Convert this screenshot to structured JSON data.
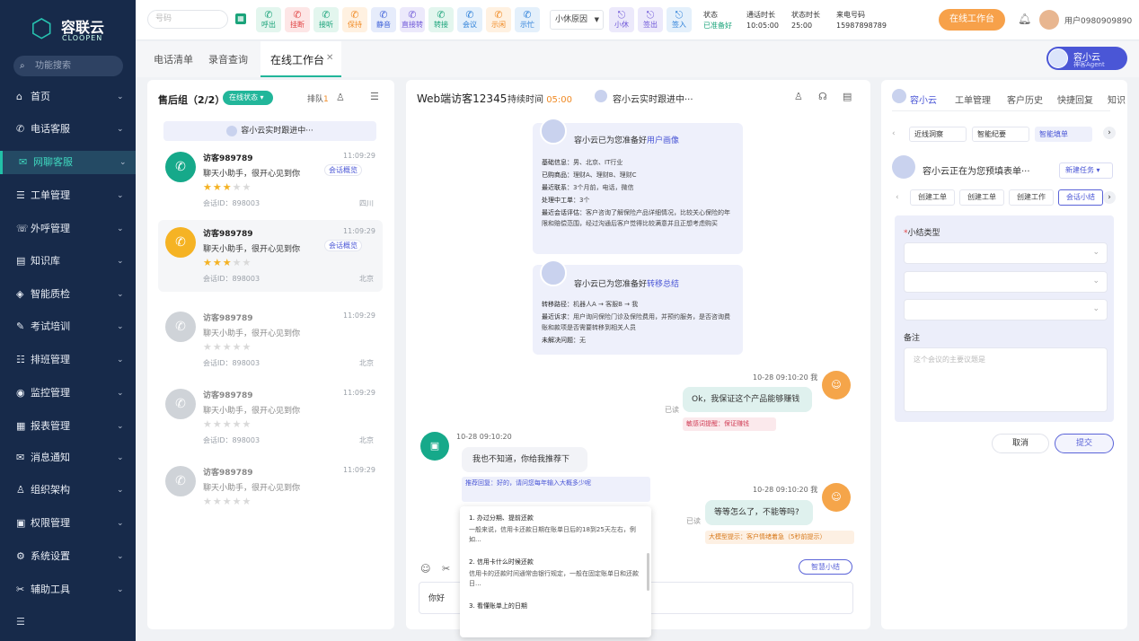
{
  "brand": {
    "title": "容联云",
    "subtitle": "CLOOPEN"
  },
  "sidebar": {
    "search_placeholder": "功能搜索",
    "items": [
      {
        "icon": "home-icon",
        "glyph": "⌂",
        "label": "首页"
      },
      {
        "icon": "phone-icon",
        "glyph": "✆",
        "label": "电话客服"
      },
      {
        "icon": "chat-icon",
        "glyph": "✉",
        "label": "网聊客服"
      },
      {
        "icon": "ticket-icon",
        "glyph": "☰",
        "label": "工单管理"
      },
      {
        "icon": "outbound-icon",
        "glyph": "☏",
        "label": "外呼管理"
      },
      {
        "icon": "book-icon",
        "glyph": "▤",
        "label": "知识库"
      },
      {
        "icon": "shield-icon",
        "glyph": "◈",
        "label": "智能质检"
      },
      {
        "icon": "exam-icon",
        "glyph": "✎",
        "label": "考试培训"
      },
      {
        "icon": "schedule-icon",
        "glyph": "☷",
        "label": "排班管理"
      },
      {
        "icon": "monitor-icon",
        "glyph": "◉",
        "label": "监控管理"
      },
      {
        "icon": "report-icon",
        "glyph": "▦",
        "label": "报表管理"
      },
      {
        "icon": "bell-icon",
        "glyph": "✉",
        "label": "消息通知"
      },
      {
        "icon": "org-icon",
        "glyph": "♙",
        "label": "组织架构"
      },
      {
        "icon": "permission-icon",
        "glyph": "▣",
        "label": "权限管理"
      },
      {
        "icon": "settings-icon",
        "glyph": "⚙",
        "label": "系统设置"
      },
      {
        "icon": "tool-icon",
        "glyph": "✂",
        "label": "辅助工具"
      }
    ]
  },
  "topbar": {
    "search_placeholder": "号码",
    "tools": [
      {
        "label": "呼出",
        "bg": "#e3f6ee",
        "fg": "#1aa37a"
      },
      {
        "label": "挂断",
        "bg": "#fde6e6",
        "fg": "#e04545"
      },
      {
        "label": "接听",
        "bg": "#e3f6ee",
        "fg": "#1aa37a"
      },
      {
        "label": "保持",
        "bg": "#fff1e1",
        "fg": "#f08a24"
      },
      {
        "label": "静音",
        "bg": "#e6ecfb",
        "fg": "#4062d8"
      },
      {
        "label": "直接转",
        "bg": "#ece9fb",
        "fg": "#6f58d8"
      },
      {
        "label": "转接",
        "bg": "#e3f6ee",
        "fg": "#1aa37a"
      },
      {
        "label": "会议",
        "bg": "#e4f0fb",
        "fg": "#2a7ed8"
      },
      {
        "label": "示闲",
        "bg": "#fff1e1",
        "fg": "#f08a24"
      },
      {
        "label": "示忙",
        "bg": "#e4f0fb",
        "fg": "#2a7ed8"
      }
    ],
    "state_select": "小休原因",
    "tools2": [
      {
        "label": "小休",
        "bg": "#ece9fb",
        "fg": "#6f58d8"
      },
      {
        "label": "签出",
        "bg": "#ece9fb",
        "fg": "#6f58d8"
      },
      {
        "label": "签入",
        "bg": "#e4f0fb",
        "fg": "#2a7ed8"
      }
    ],
    "status_label": "状态",
    "status_value": "已准备好",
    "talk_label": "通话时长",
    "talk_value": "10:05:00",
    "state_time_label": "状态时长",
    "state_time_value": "25:00",
    "caller_label": "来电号码",
    "caller_value": "15987898789",
    "workbench_btn": "在线工作台",
    "user": "用户0980909890"
  },
  "page_tabs": [
    "电话清单",
    "录音查询",
    "在线工作台"
  ],
  "agent_badge": {
    "name": "容小云",
    "role": "神客Agent"
  },
  "queue": {
    "title": "售后组（2/2）",
    "status": "在线状态",
    "queue_label": "排队",
    "queue_count": "1",
    "banner": "容小云实时跟进中···",
    "items": [
      {
        "name": "访客989789",
        "msg": "聊天小助手，很开心见到你",
        "time": "11:09:29",
        "stars": 3,
        "id": "会话ID：898003",
        "loc": "四川",
        "tag": "会话概览",
        "color": "#16a98a",
        "active": true
      },
      {
        "name": "访客989789",
        "msg": "聊天小助手，很开心见到你",
        "time": "11:09:29",
        "stars": 3,
        "id": "会话ID：898003",
        "loc": "北京",
        "tag": "会话概览",
        "color": "#f5b324",
        "active": true
      },
      {
        "name": "访客989789",
        "msg": "聊天小助手，很开心见到你",
        "time": "11:09:29",
        "stars": 0,
        "id": "会话ID：898003",
        "loc": "北京",
        "tag": "",
        "color": "#cfd3d8",
        "active": false
      },
      {
        "name": "访客989789",
        "msg": "聊天小助手，很开心见到你",
        "time": "11:09:29",
        "stars": 0,
        "id": "会话ID：898003",
        "loc": "北京",
        "tag": "",
        "color": "#cfd3d8",
        "active": false
      },
      {
        "name": "访客989789",
        "msg": "聊天小助手，很开心见到你",
        "time": "11:09:29",
        "stars": 0,
        "id": "",
        "loc": "",
        "tag": "",
        "color": "#cfd3d8",
        "active": false
      }
    ]
  },
  "chat": {
    "title": "Web端访客12345",
    "duration_label": "持续时间",
    "duration": "05:00",
    "following": "容小云实时跟进中···",
    "portrait_card": {
      "heading_a": "容小云已为您准备好",
      "heading_b": "用户画像",
      "rows": [
        {
          "k": "基础信息：",
          "v": "男、北京、IT行业"
        },
        {
          "k": "已购商品：",
          "v": "理财A、理财B、理财C"
        },
        {
          "k": "最近联系：",
          "v": "3个月前，电话，微信"
        },
        {
          "k": "处理中工单：",
          "v": "3个"
        },
        {
          "k": "最近会话评估：",
          "v": "客户咨询了解保险产品详细情况，比较关心保险的年限和赔偿范围，经过沟通后客户觉得比较满意并且正想考虑购买"
        }
      ]
    },
    "transfer_card": {
      "heading_a": "容小云已为您准备好",
      "heading_b": "转移总结",
      "rows": [
        {
          "k": "转移路径：",
          "v": "机器人A → 客服B → 我"
        },
        {
          "k": "最近诉求：",
          "v": "用户询问保险门诊及保险费用，并预约服务，是否咨询费账和款项是否需要转移到相关人员"
        },
        {
          "k": "未解决问题：",
          "v": "无"
        }
      ]
    },
    "msg_out1": {
      "time": "10-28 09:10:20",
      "who": "我",
      "text": "Ok，我保证这个产品能够赚钱",
      "read": "已读",
      "hint_label": "敏感词提醒：",
      "hint_value": "保证赚钱"
    },
    "msg_in": {
      "time": "10-28 09:10:20",
      "text": "我也不知道，你给我推荐下",
      "rec_label": "推荐回复：",
      "rec_text": "好的，请问您每年输入大概多少呢"
    },
    "msg_out2": {
      "time": "10-28 09:10:20",
      "who": "我",
      "text": "等等怎么了，不能等吗?",
      "read": "已读",
      "hint_label": "大模型提示：",
      "hint_value": "客户情绪着急（5秒前提示）"
    },
    "suggestions": [
      {
        "title": "1. 办过分期、提前还款",
        "body": "一般来说，信用卡还款日期在账单日后的18到25天左右，例如..."
      },
      {
        "title": "2. 信用卡什么时候还款",
        "body": "信用卡的还款时间通常由银行规定，一般在固定账单日和还款日..."
      },
      {
        "title": "3. 看懂账单上的日期",
        "body": ""
      }
    ],
    "smart_summary": "智慧小结",
    "input_value": "你好"
  },
  "right": {
    "tabs": [
      "容小云",
      "工单管理",
      "客户历史",
      "快捷回复",
      "知识"
    ],
    "subtabs": [
      "近线洞察",
      "智能纪要",
      "智能填单"
    ],
    "filling": "容小云正在为您预填表单···",
    "new_task": "新建任务",
    "actions": [
      "创建工单",
      "创建工单",
      "创建工作",
      "会话小结"
    ],
    "form": {
      "type_label": "小结类型",
      "note_label": "备注",
      "note_placeholder": "这个会议的主要议题是"
    },
    "cancel": "取消",
    "submit": "提交"
  }
}
